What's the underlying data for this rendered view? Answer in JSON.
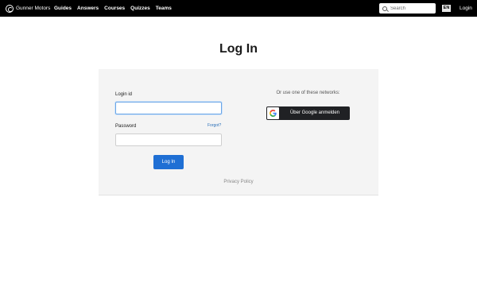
{
  "header": {
    "brand": "Gunner Motors",
    "nav": [
      "Guides",
      "Answers",
      "Courses",
      "Quizzes",
      "Teams"
    ],
    "search_placeholder": "Search",
    "language": "EN",
    "login_label": "Login"
  },
  "main": {
    "title": "Log In",
    "login_id_label": "Login id",
    "login_id_value": "",
    "password_label": "Password",
    "password_value": "",
    "forgot_label": "Forgot?",
    "submit_label": "Log In",
    "networks_text": "Or use one of these networks:",
    "google_label": "Über Google anmelden",
    "privacy_label": "Privacy Policy"
  },
  "colors": {
    "topbar": "#000000",
    "primary_button": "#1f6fd4",
    "google_button": "#202124",
    "link": "#2a6fb8",
    "card_background": "#f4f4f4"
  },
  "icons": {
    "brand": "gunner-motors-logo-icon",
    "search": "search-icon",
    "google": "google-g-icon"
  }
}
